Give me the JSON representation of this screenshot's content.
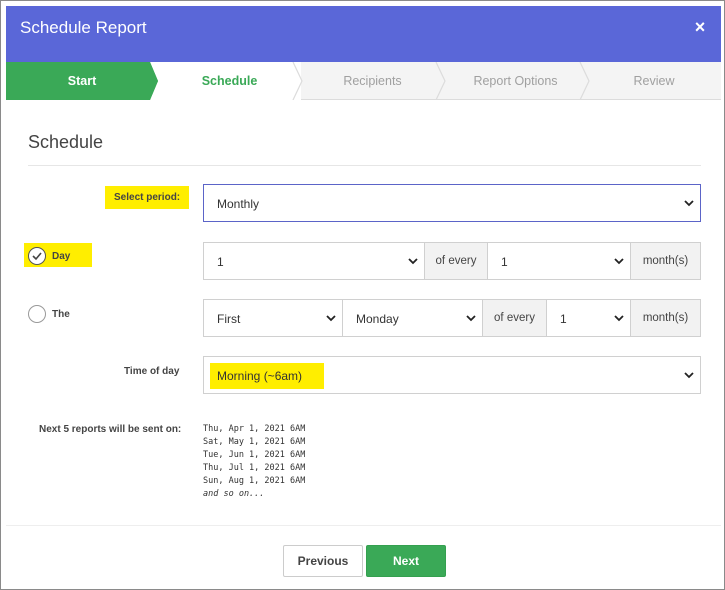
{
  "header": {
    "title": "Schedule Report",
    "close_glyph": "×"
  },
  "wizard": {
    "steps": [
      {
        "label": "Start",
        "state": "done"
      },
      {
        "label": "Schedule",
        "state": "current"
      },
      {
        "label": "Recipients",
        "state": "pending"
      },
      {
        "label": "Report Options",
        "state": "pending"
      },
      {
        "label": "Review",
        "state": "pending"
      }
    ]
  },
  "section": {
    "title": "Schedule"
  },
  "period": {
    "label": "Select period:",
    "value": "Monthly"
  },
  "day_option": {
    "label": "Day",
    "checked": true,
    "day_value": "1",
    "of_every": "of every",
    "interval_value": "1",
    "unit": "month(s)"
  },
  "the_option": {
    "label": "The",
    "checked": false,
    "ordinal_value": "First",
    "weekday_value": "Monday",
    "of_every": "of every",
    "interval_value": "1",
    "unit": "month(s)"
  },
  "time_of_day": {
    "label": "Time of day",
    "value": "Morning (~6am)"
  },
  "next_reports": {
    "label": "Next 5 reports will be sent on:",
    "dates": [
      "Thu, Apr 1, 2021 6AM",
      "Sat, May 1, 2021 6AM",
      "Tue, Jun 1, 2021 6AM",
      "Thu, Jul 1, 2021 6AM",
      "Sun, Aug 1, 2021 6AM"
    ],
    "more": "and so on..."
  },
  "footer": {
    "previous_label": "Previous",
    "next_label": "Next"
  },
  "colors": {
    "header": "#5a67d8",
    "accent": "#3aa957",
    "highlight": "#ffee00"
  }
}
